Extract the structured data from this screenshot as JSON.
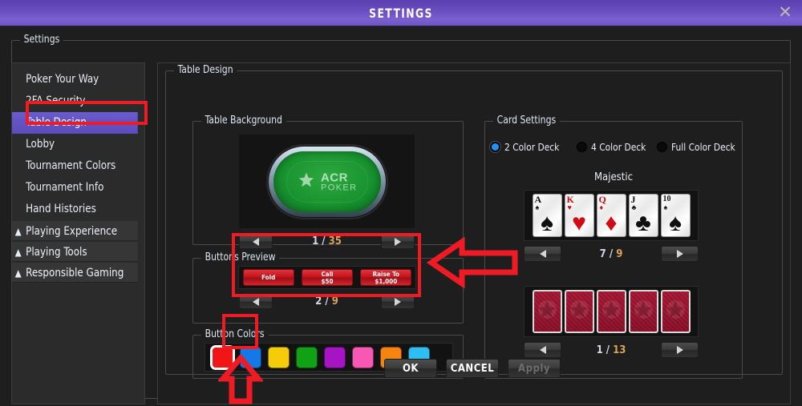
{
  "titlebar": {
    "title": "SETTINGS",
    "close_icon": "close-icon"
  },
  "settings_group_label": "Settings",
  "sidebar": {
    "items": [
      {
        "label": "Poker Your Way",
        "selected": false
      },
      {
        "label": "2FA Security",
        "selected": false
      },
      {
        "label": "Table Design",
        "selected": true
      },
      {
        "label": "Lobby",
        "selected": false
      },
      {
        "label": "Tournament Colors",
        "selected": false
      },
      {
        "label": "Tournament Info",
        "selected": false
      },
      {
        "label": "Hand Histories",
        "selected": false
      }
    ],
    "groups": [
      {
        "label": "Playing Experience",
        "icon": "chevron-up-icon"
      },
      {
        "label": "Playing Tools",
        "icon": "chevron-up-icon"
      },
      {
        "label": "Responsible Gaming",
        "icon": "chevron-up-icon"
      }
    ]
  },
  "main": {
    "title": "Table Design",
    "table_background": {
      "label": "Table Background",
      "logo_line1": "ACR",
      "logo_line2": "POKER",
      "current": "1",
      "separator": "/",
      "total": "35",
      "prev_icon": "arrow-left-icon",
      "next_icon": "arrow-right-icon"
    },
    "buttons_preview": {
      "label": "Buttons Preview",
      "buttons": [
        {
          "line1": "Fold",
          "line2": ""
        },
        {
          "line1": "Call",
          "line2": "$50"
        },
        {
          "line1": "Raise To",
          "line2": "$1,000"
        }
      ],
      "current": "2",
      "separator": "/",
      "total": "9",
      "prev_icon": "arrow-left-icon",
      "next_icon": "arrow-right-icon"
    },
    "button_colors": {
      "label": "Button Colors",
      "swatches": [
        {
          "name": "red",
          "hex": "#f21515",
          "selected": true
        },
        {
          "name": "blue",
          "hex": "#1478e6",
          "selected": false
        },
        {
          "name": "yellow",
          "hex": "#f5cc0a",
          "selected": false
        },
        {
          "name": "green",
          "hex": "#11a114",
          "selected": false
        },
        {
          "name": "purple",
          "hex": "#a614c4",
          "selected": false
        },
        {
          "name": "pink",
          "hex": "#f758b4",
          "selected": false
        },
        {
          "name": "orange",
          "hex": "#f58410",
          "selected": false
        },
        {
          "name": "cyan",
          "hex": "#2fbdf2",
          "selected": false
        }
      ]
    },
    "card_settings": {
      "label": "Card Settings",
      "deck_options": [
        {
          "label": "2 Color Deck",
          "selected": true
        },
        {
          "label": "4 Color Deck",
          "selected": false
        },
        {
          "label": "Full Color Deck",
          "selected": false
        }
      ],
      "deck_name": "Majestic",
      "card_faces": [
        {
          "rank": "A",
          "suit": "♠",
          "color": "black"
        },
        {
          "rank": "K",
          "suit": "♥",
          "color": "red"
        },
        {
          "rank": "Q",
          "suit": "♦",
          "color": "red"
        },
        {
          "rank": "J",
          "suit": "♣",
          "color": "black"
        },
        {
          "rank": "10",
          "suit": "♠",
          "color": "black"
        }
      ],
      "faces_current": "7",
      "faces_separator": "/",
      "faces_total": "9",
      "backs_count": 5,
      "backs_current": "1",
      "backs_separator": "/",
      "backs_total": "13",
      "prev_icon": "arrow-left-icon",
      "next_icon": "arrow-right-icon"
    }
  },
  "footer": {
    "ok": "OK",
    "cancel": "CANCEL",
    "apply": "Apply",
    "apply_disabled": true
  },
  "annotations": {
    "highlight_color": "#ee1b24",
    "arrow_left_icon": "annotation-arrow-left",
    "arrow_up_icon": "annotation-arrow-up"
  }
}
